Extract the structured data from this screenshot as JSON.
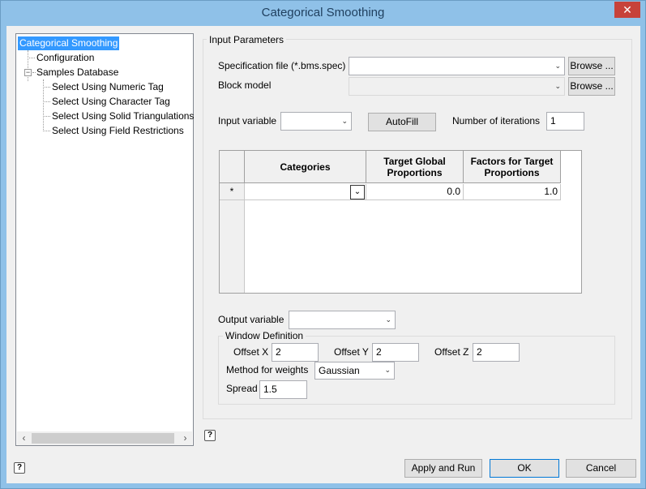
{
  "window": {
    "title": "Categorical Smoothing",
    "close_glyph": "✕"
  },
  "tree": {
    "items": [
      {
        "label": "Categorical Smoothing"
      },
      {
        "label": "Configuration"
      },
      {
        "label": "Samples Database"
      },
      {
        "label": "Select Using Numeric Tag"
      },
      {
        "label": "Select Using Character Tag"
      },
      {
        "label": "Select Using Solid Triangulations"
      },
      {
        "label": "Select Using Field Restrictions"
      }
    ]
  },
  "input_parameters": {
    "group_label": "Input Parameters",
    "spec_file_label": "Specification file (*.bms.spec)",
    "spec_file_value": "",
    "block_model_label": "Block model",
    "block_model_value": "",
    "browse_label": "Browse ...",
    "input_variable_label": "Input variable",
    "input_variable_value": "",
    "autofill_label": "AutoFill",
    "iterations_label": "Number of iterations",
    "iterations_value": "1"
  },
  "grid": {
    "columns": [
      "Categories",
      "Target Global Proportions",
      "Factors for Target Proportions"
    ],
    "rows": [
      {
        "marker": "*",
        "category": "",
        "target_global": "0.0",
        "factors": "1.0"
      }
    ]
  },
  "output": {
    "output_variable_label": "Output variable",
    "output_variable_value": ""
  },
  "window_definition": {
    "group_label": "Window Definition",
    "offset_x_label": "Offset X",
    "offset_x_value": "2",
    "offset_y_label": "Offset Y",
    "offset_y_value": "2",
    "offset_z_label": "Offset Z",
    "offset_z_value": "2",
    "method_label": "Method for weights",
    "method_value": "Gaussian",
    "spread_label": "Spread",
    "spread_value": "1.5"
  },
  "footer": {
    "apply_label": "Apply and Run",
    "ok_label": "OK",
    "cancel_label": "Cancel",
    "help_glyph": "?"
  },
  "icons": {
    "chevron": "⌄",
    "expander_minus": "−",
    "scroll_left": "‹",
    "scroll_right": "›"
  }
}
